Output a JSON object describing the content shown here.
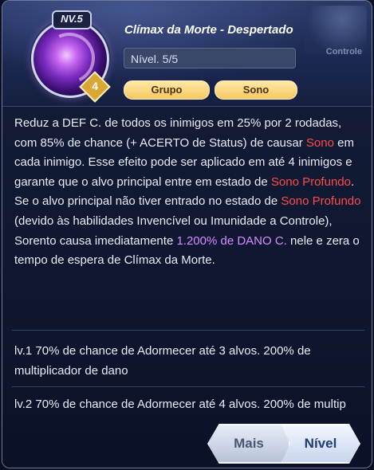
{
  "skill": {
    "badge": "NV.5",
    "rank": "4",
    "title": "Clímax da Morte - Despertado",
    "level_text": "Nível. 5/5",
    "tags": [
      "Grupo",
      "Sono"
    ]
  },
  "corner_label": "Controle",
  "description": {
    "p1_a": "Reduz a DEF C. de todos os inimigos em 25% por 2 rodadas, com 85% de chance (+ ACERTO de Status) de causar ",
    "p1_hl1": "Sono",
    "p1_b": " em cada inimigo. Esse efeito pode ser aplicado em até 4 inimigos e garante que o alvo principal entre em estado de ",
    "p1_hl2": "Sono Profundo",
    "p1_c": ".",
    "p2_a": "Se o alvo principal não tiver entrado no estado de ",
    "p2_hl1": "Sono Profundo",
    "p2_b": " (devido às habilidades Invencível ou Imunidade a Controle), Sorento causa imediatamente ",
    "p2_hl2": "1.200% de DANO C.",
    "p2_c": " nele e zera o tempo de espera de Clímax da Morte."
  },
  "levels": [
    "lv.1 70% de chance de Adormecer até 3 alvos. 200% de multiplicador de dano",
    "lv.2 70% de chance de Adormecer até 4 alvos. 200% de multip"
  ],
  "buttons": {
    "more": "Mais",
    "level": "Nível"
  },
  "colors": {
    "highlight": "#ff4b4b",
    "damage_highlight": "#d98bff",
    "tag": "#f6c860"
  }
}
